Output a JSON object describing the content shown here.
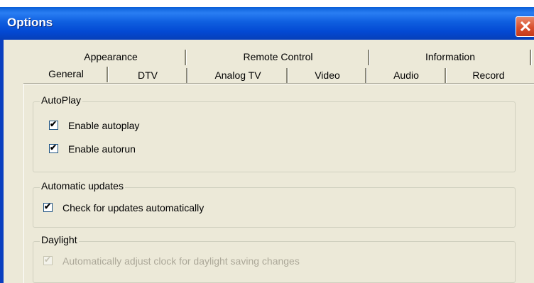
{
  "window": {
    "title": "Options",
    "close_label": "✕",
    "close_icon": "close-icon"
  },
  "tabs_row1": [
    "Appearance",
    "Remote Control",
    "Information"
  ],
  "tabs_row2": [
    "General",
    "DTV",
    "Analog TV",
    "Video",
    "Audio",
    "Record"
  ],
  "active_tab": "General",
  "groups": {
    "autoplay": {
      "title": "AutoPlay",
      "items": [
        {
          "label": "Enable autoplay",
          "checked": true
        },
        {
          "label": "Enable autorun",
          "checked": true
        }
      ]
    },
    "updates": {
      "title": "Automatic updates",
      "items": [
        {
          "label": "Check for updates automatically",
          "checked": true
        }
      ]
    },
    "daylight": {
      "title": "Daylight",
      "items": [
        {
          "label": "Automatically adjust clock for daylight saving changes",
          "checked": true,
          "disabled": true
        }
      ]
    }
  },
  "colors": {
    "titlebar": "#0349d3",
    "client": "#ece9d8",
    "close": "#d9502e"
  }
}
